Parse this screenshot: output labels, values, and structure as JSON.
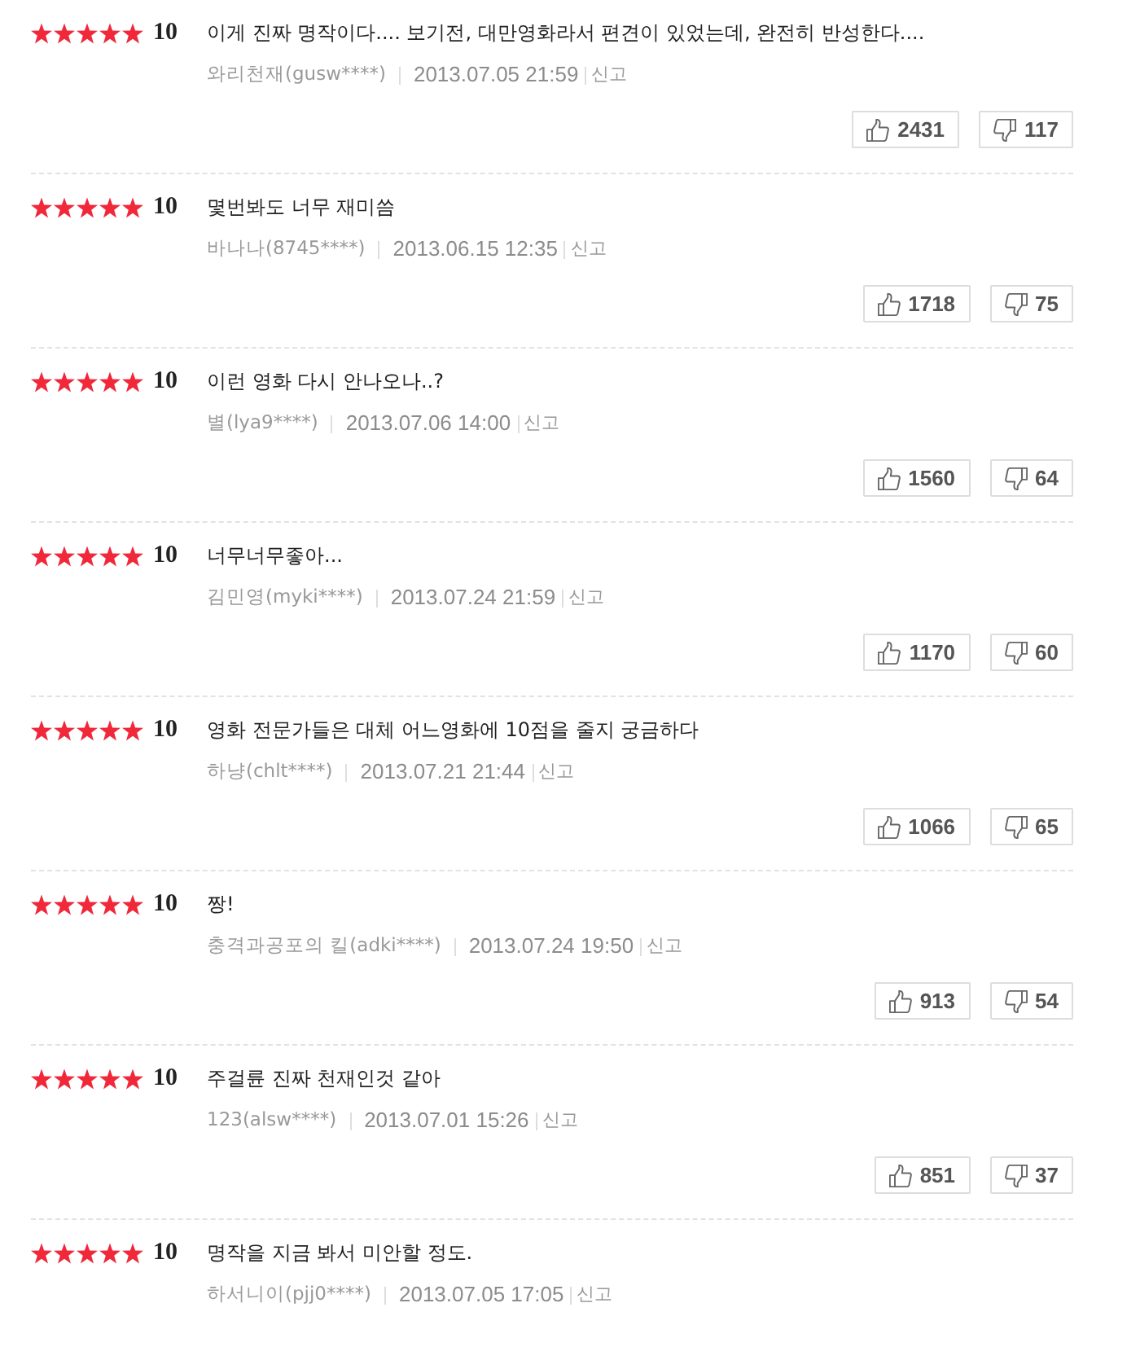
{
  "reviews": [
    {
      "stars": 5,
      "score": "10",
      "comment": "이게 진짜 명작이다.... 보기전, 대만영화라서 편견이 있었는데, 완전히 반성한다....",
      "author": "와리천재(gusw****)",
      "date": "2013.07.05 21:59",
      "report": "신고",
      "likes": "2431",
      "dislikes": "117"
    },
    {
      "stars": 5,
      "score": "10",
      "comment": "몇번봐도 너무 재미씀",
      "author": "바나나(8745****)",
      "date": "2013.06.15 12:35",
      "report": "신고",
      "likes": "1718",
      "dislikes": "75"
    },
    {
      "stars": 5,
      "score": "10",
      "comment": "이런 영화 다시 안나오나..?",
      "author": "별(lya9****)",
      "date": "2013.07.06 14:00",
      "report": "신고",
      "likes": "1560",
      "dislikes": "64"
    },
    {
      "stars": 5,
      "score": "10",
      "comment": "너무너무좋아...",
      "author": "김민영(myki****)",
      "date": "2013.07.24 21:59",
      "report": "신고",
      "likes": "1170",
      "dislikes": "60"
    },
    {
      "stars": 5,
      "score": "10",
      "comment": "영화 전문가들은 대체 어느영화에 10점을 줄지 궁금하다",
      "author": "하냥(chlt****)",
      "date": "2013.07.21 21:44",
      "report": "신고",
      "likes": "1066",
      "dislikes": "65"
    },
    {
      "stars": 5,
      "score": "10",
      "comment": "짱!",
      "author": "충격과공포의 킬(adki****)",
      "date": "2013.07.24 19:50",
      "report": "신고",
      "likes": "913",
      "dislikes": "54"
    },
    {
      "stars": 5,
      "score": "10",
      "comment": "주걸륜 진짜 천재인것 같아",
      "author": "123(alsw****)",
      "date": "2013.07.01 15:26",
      "report": "신고",
      "likes": "851",
      "dislikes": "37"
    },
    {
      "stars": 5,
      "score": "10",
      "comment": "명작을 지금 봐서 미안할 정도.",
      "author": "하서니이(pjj0****)",
      "date": "2013.07.05 17:05",
      "report": "신고"
    }
  ]
}
